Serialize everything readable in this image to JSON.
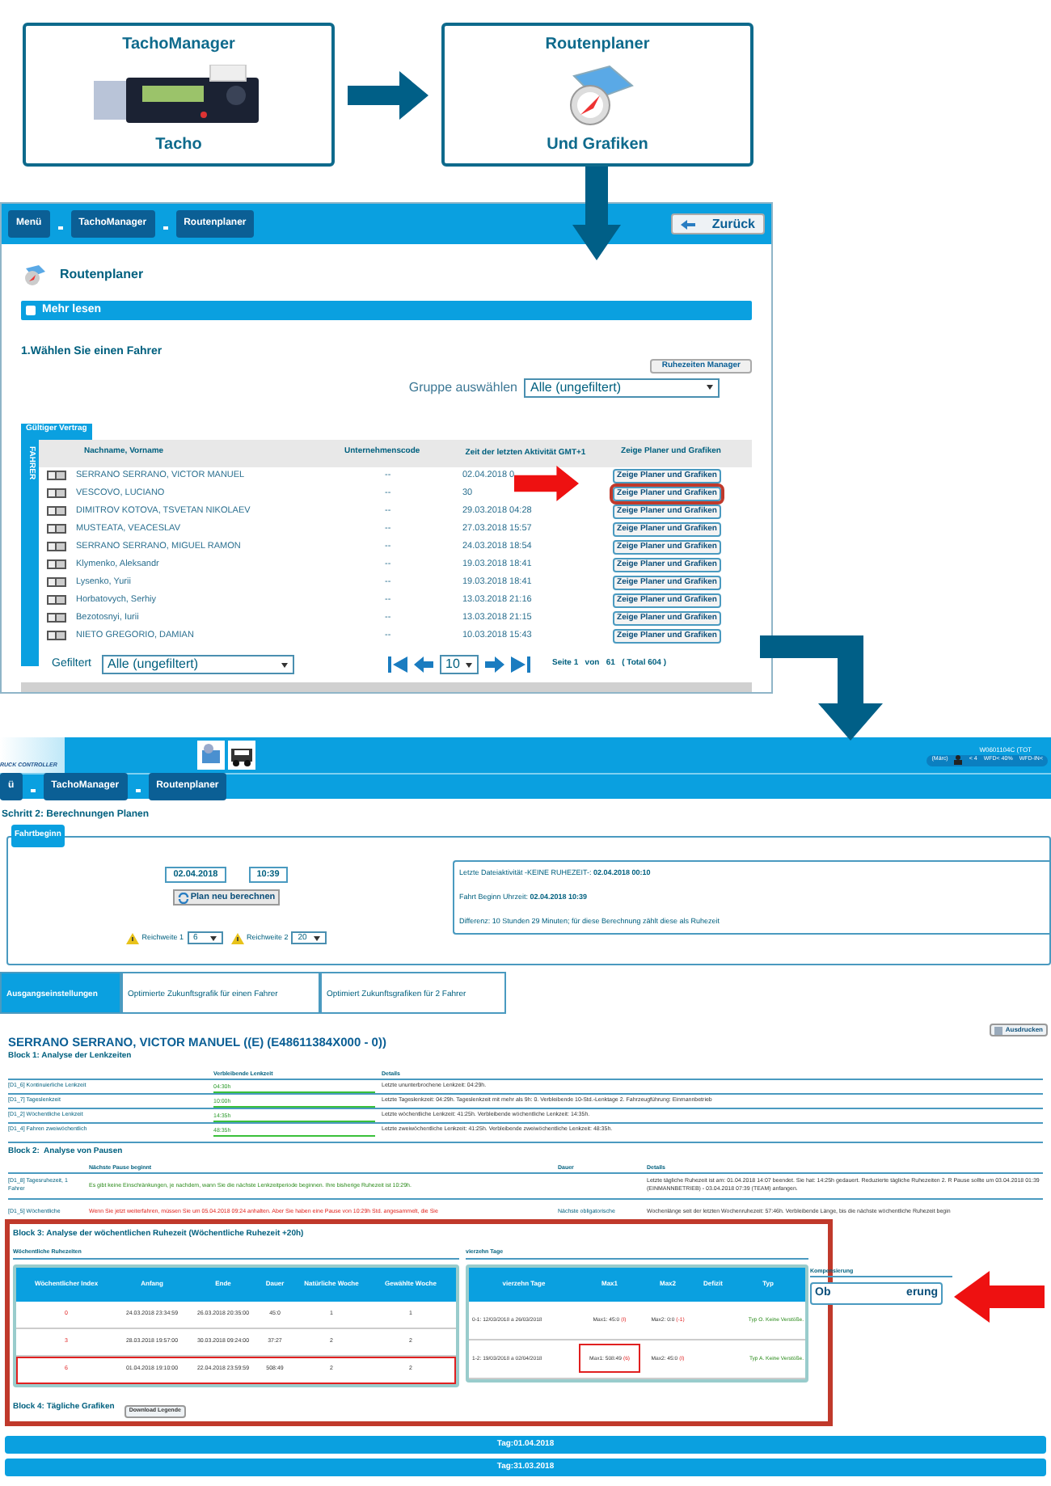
{
  "flow": {
    "boxes": [
      {
        "title": "TachoManager",
        "caption": "Tacho",
        "kind": "tacho"
      },
      {
        "title": "Routenplaner",
        "caption": "Und Grafiken",
        "kind": "compass"
      }
    ]
  },
  "panel": {
    "breadcrumb": [
      "Menü",
      "TachoManager",
      "Routenplaner"
    ],
    "back_button": "Zurück",
    "heading": "Routenplaner",
    "expander": "Mehr lesen",
    "step": "1.Wählen Sie einen Fahrer",
    "manager_button": "Ruhezeiten Manager",
    "group_label": "Gruppe auswählen",
    "group_value": "Alle (ungefiltert)",
    "tab": "Gültiger Vertrag",
    "side_label": "FAHRER",
    "columns": [
      "Nachname, Vorname",
      "Unternehmenscode",
      "Zeit der letzten Aktivität GMT+1",
      "Zeige Planer und Grafiken"
    ],
    "rows": [
      {
        "name": "SERRANO SERRANO, VICTOR MANUEL",
        "code": "--",
        "time": "02.04.2018 0",
        "action": "Zeige Planer und Grafiken",
        "highlighted": false
      },
      {
        "name": "VESCOVO, LUCIANO",
        "code": "--",
        "time": "30",
        "action": "Zeige Planer und Grafiken",
        "highlighted": true
      },
      {
        "name": "DIMITROV KOTOVA, TSVETAN NIKOLAEV",
        "code": "--",
        "time": "29.03.2018 04:28",
        "action": "Zeige Planer und Grafiken",
        "highlighted": false
      },
      {
        "name": "MUSTEATA, VEACESLAV",
        "code": "--",
        "time": "27.03.2018 15:57",
        "action": "Zeige Planer und Grafiken",
        "highlighted": false
      },
      {
        "name": "SERRANO SERRANO, MIGUEL RAMON",
        "code": "--",
        "time": "24.03.2018 18:54",
        "action": "Zeige Planer und Grafiken",
        "highlighted": false
      },
      {
        "name": "Klymenko, Aleksandr",
        "code": "--",
        "time": "19.03.2018 18:41",
        "action": "Zeige Planer und Grafiken",
        "highlighted": false
      },
      {
        "name": "Lysenko, Yurii",
        "code": "--",
        "time": "19.03.2018 18:41",
        "action": "Zeige Planer und Grafiken",
        "highlighted": false
      },
      {
        "name": "Horbatovych, Serhiy",
        "code": "--",
        "time": "13.03.2018 21:16",
        "action": "Zeige Planer und Grafiken",
        "highlighted": false
      },
      {
        "name": "Bezotosnyi, Iurii",
        "code": "--",
        "time": "13.03.2018 21:15",
        "action": "Zeige Planer und Grafiken",
        "highlighted": false
      },
      {
        "name": "NIETO GREGORIO, DAMIAN",
        "code": "--",
        "time": "10.03.2018 15:43",
        "action": "Zeige Planer und Grafiken",
        "highlighted": false
      }
    ],
    "filter_label": "Gefiltert",
    "filter_value": "Alle (ungefiltert)",
    "page_size": "10",
    "page_info": "Seite 1   von   61   ( Total 604 )"
  },
  "app": {
    "logo": "RUCK CONTROLLER",
    "user": "W0601104C (TOT",
    "status": [
      "(Märc)",
      "< 4",
      "WFD< 40%",
      "WFD-IN<"
    ],
    "breadcrumb": [
      "ü",
      "TachoManager",
      "Routenplaner"
    ],
    "step": "Schritt 2: Berechnungen Planen",
    "fieldset": "Fahrtbeginn",
    "date": "02.04.2018",
    "time": "10:39",
    "recalc": "Plan neu berechnen",
    "range1_label": "Reichweite 1",
    "range1": "6",
    "range2_label": "Reichweite 2",
    "range2": "20",
    "info": [
      "Letzte Dateiaktivität -KEINE RUHEZEIT-: **02.04.2018 00:10**",
      "Fahrt Beginn Uhrzeit: **02.04.2018 10:39**",
      "Differenz: 10 Stunden 29 Minuten; für diese Berechnung zählt diese als Ruhezeit"
    ],
    "tabs": [
      {
        "label": "Ausgangseinstellungen",
        "selected": true
      },
      {
        "label": "Optimierte Zukunftsgrafik für einen Fahrer",
        "selected": false
      },
      {
        "label": "Optimiert Zukunftsgrafiken für 2 Fahrer",
        "selected": false
      }
    ],
    "print": "Ausdrucken",
    "driver": "SERRANO SERRANO, VICTOR MANUEL ((E) (E48611384X000 - 0))",
    "block1": {
      "title": "Block 1: Analyse der Lenkzeiten",
      "columns": [
        "Verbleibende Lenkzeit",
        "Details"
      ],
      "rows": [
        {
          "label": "[D1_6] Kontinuierliche Lenkzeit",
          "value": "04:30h",
          "details": "Letzte ununterbrochene Lenkzeit: 04:29h."
        },
        {
          "label": "[D1_7] Tageslenkzeit",
          "value": "10:00h",
          "details": "Letzte Tageslenkzeit: 04:29h. Tageslenkzeit mit mehr als 9h: 0. Verbleibende 10-Std.-Lenktage 2. Fahrzeugführung: Einmannbetrieb"
        },
        {
          "label": "[D1_2] Wöchentliche Lenkzeit",
          "value": "14:35h",
          "details": "Letzte wöchentliche Lenkzeit: 41:25h. Verbleibende wöchentliche Lenkzeit: 14:35h."
        },
        {
          "label": "[D1_4] Fahren zweiwöchentlich",
          "value": "48:35h",
          "details": "Letzte zweiwöchentliche Lenkzeit: 41:25h. Verbleibende zweiwöchentliche Lenkzeit: 48:35h."
        }
      ]
    },
    "block2": {
      "title": "Block 2:  Analyse von Pausen",
      "columns": [
        "Nächste Pause beginnt",
        "Dauer",
        "Details"
      ],
      "rows": [
        {
          "label": "[D1_8] Tagesruhezeit, 1 Fahrer",
          "kind": "ok",
          "next": "Es gibt keine Einschränkungen, je nachdem, wann Sie die nächste Lenkzeitperiode beginnen. Ihre bisherige Ruhezeit ist 10:29h.",
          "details": "Letzte tägliche Ruhezeit ist am: 01.04.2018 14:07 beendet. Sie hat: 14:25h gedauert. Reduzierte tägliche Ruhezeiten 2. R Pause sollte um 03.04.2018 01:39 (EINMANNBETRIEB) - 03.04.2018 07:39 (TEAM) anfangen."
        },
        {
          "label": "[D1_5] Wöchentliche",
          "kind": "warning",
          "next": "Wenn Sie jetzt weiterfahren, müssen Sie um 05.04.2018 09:24 anhalten. Aber Sie haben eine Pause von 10:29h Std. angesammelt, die Sie",
          "duration": "Nächste obligatorische",
          "details": "Wochenlänge seit der letzten Wochenruhezeit: 57:46h. Verbleibende Länge, bis die nächste wöchentliche Ruhezeit begin"
        }
      ]
    },
    "block3": {
      "title": "Block 3: Analyse der wöchentlichen Ruhezeit (Wöchentliche Ruhezeit +20h)",
      "weekly": {
        "title": "Wöchentliche Ruhezeiten",
        "columns": [
          "Wöchentlicher Index",
          "Anfang",
          "Ende",
          "Dauer",
          "Natürliche Woche",
          "Gewählte Woche"
        ],
        "rows": [
          {
            "cells": [
              "0",
              "24.03.2018 23:34:59",
              "26.03.2018 20:35:00",
              "45:0",
              "1",
              "1"
            ],
            "highlighted": false
          },
          {
            "cells": [
              "3",
              "28.03.2018 19:57:00",
              "30.03.2018 09:24:00",
              "37:27",
              "2",
              "2"
            ],
            "highlighted": false
          },
          {
            "cells": [
              "6",
              "01.04.2018 19:10:00",
              "22.04.2018 23:59:59",
              "508:49",
              "2",
              "2"
            ],
            "highlighted": true
          }
        ]
      },
      "fortnight": {
        "title": "vierzehn Tage",
        "columns": [
          "vierzehn Tage",
          "Max1",
          "Max2",
          "Defizit",
          "Typ"
        ],
        "rows": [
          {
            "period": "0-1:  12/03/2018 a 26/03/2018",
            "max1": "Max1: 45:0",
            "max1_flag": "(I)",
            "max2": "Max2: 0:0",
            "max2_flag": "(-1)",
            "type": "Typ O. Keine Verstöße.",
            "highlighted": false
          },
          {
            "period": "1-2:  19/03/2018 a 02/04/2018",
            "max1": "Max1: 508:49",
            "max1_flag": "(6)",
            "max2": "Max2: 45:0",
            "max2_flag": "(I)",
            "type": "Typ A. Keine Verstöße.",
            "highlighted": true
          }
        ]
      },
      "compensation": {
        "title": "Kompensierung",
        "button_parts": [
          "Ob",
          "erung"
        ]
      }
    },
    "block4": {
      "title": "Block 4: Tägliche Grafiken",
      "button": "Download Legende"
    },
    "days": [
      "Tag:01.04.2018",
      "Tag:31.03.2018"
    ]
  }
}
